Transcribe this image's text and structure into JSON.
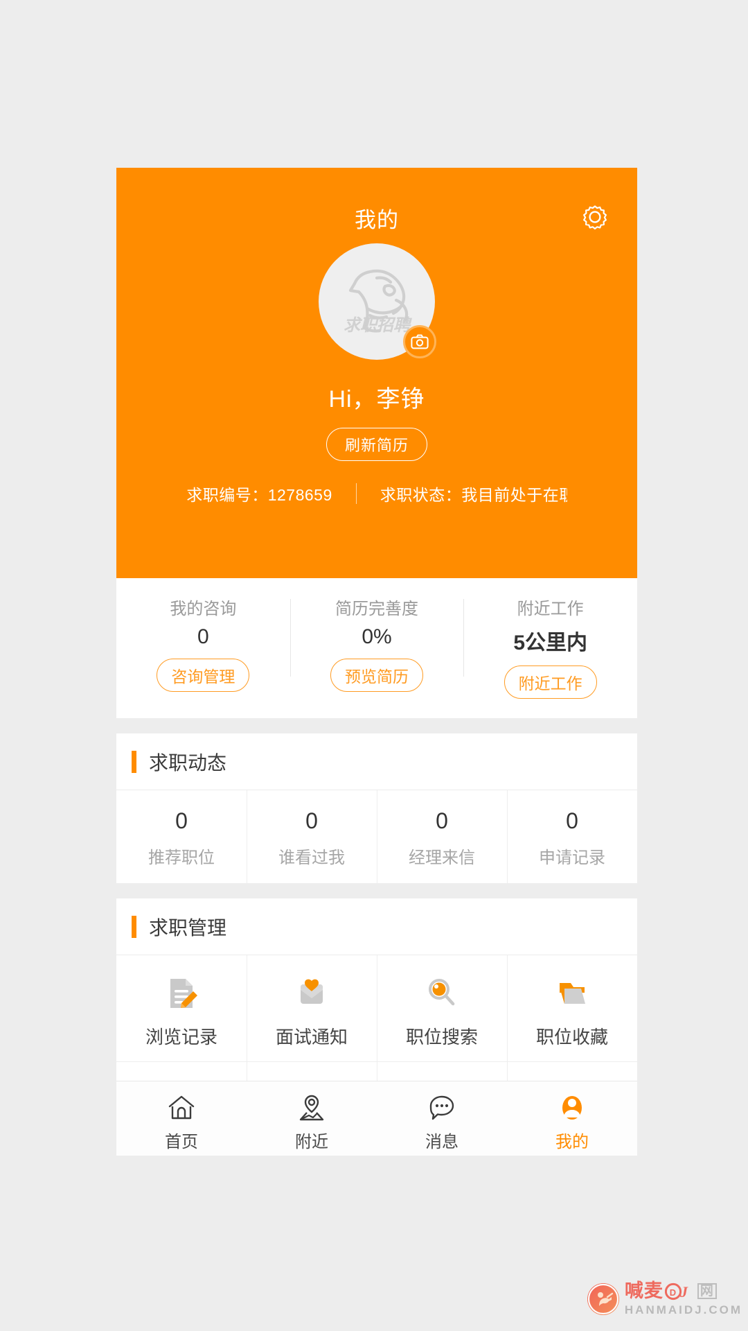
{
  "app": {
    "theme_color": "#FF8C00",
    "accent_color": "#FF9B22",
    "page_background": "#EDEDED",
    "card_background": "#FFFFFF"
  },
  "header": {
    "title": "我的",
    "settings_icon": "gear-icon",
    "avatar": {
      "placeholder_text": "求职招聘",
      "camera_icon": "camera-icon"
    },
    "greeting": "Hi，李铮",
    "refresh_resume_label": "刷新简历",
    "meta": {
      "job_number_label": "求职编号：",
      "job_number_value": "1278659",
      "job_status_label": "求职状态：",
      "job_status_value": "我目前处于在职…"
    }
  },
  "stats": [
    {
      "label": "我的咨询",
      "value": "0",
      "button": "咨询管理"
    },
    {
      "label": "简历完善度",
      "value": "0%",
      "button": "预览简历"
    },
    {
      "label": "附近工作",
      "value": "5公里内",
      "button": "附近工作"
    }
  ],
  "dynamics": {
    "section_title": "求职动态",
    "items": [
      {
        "value": "0",
        "label": "推荐职位"
      },
      {
        "value": "0",
        "label": "谁看过我"
      },
      {
        "value": "0",
        "label": "经理来信"
      },
      {
        "value": "0",
        "label": "申请记录"
      }
    ]
  },
  "management": {
    "section_title": "求职管理",
    "row1": [
      {
        "label": "浏览记录",
        "icon": "document-pencil-icon"
      },
      {
        "label": "面试通知",
        "icon": "envelope-heart-icon"
      },
      {
        "label": "职位搜索",
        "icon": "magnifier-icon"
      },
      {
        "label": "职位收藏",
        "icon": "folder-open-icon"
      }
    ],
    "row2": [
      {
        "label": "",
        "icon": "heart-bell-icon"
      },
      {
        "label": "",
        "icon": "eye-slash-icon"
      },
      {
        "label": "",
        "icon": "money-bag-icon"
      },
      {
        "label": "",
        "icon": "resume-pencil-icon"
      }
    ]
  },
  "tabbar": [
    {
      "label": "首页",
      "icon": "home-icon",
      "active": false
    },
    {
      "label": "附近",
      "icon": "map-pin-icon",
      "active": false
    },
    {
      "label": "消息",
      "icon": "chat-bubble-icon",
      "active": false
    },
    {
      "label": "我的",
      "icon": "person-icon",
      "active": true
    }
  ],
  "watermark": {
    "cn_left": "喊麦",
    "cn_dj": "DJ",
    "cn_right": "网",
    "en": "HANMAIDJ.COM"
  }
}
